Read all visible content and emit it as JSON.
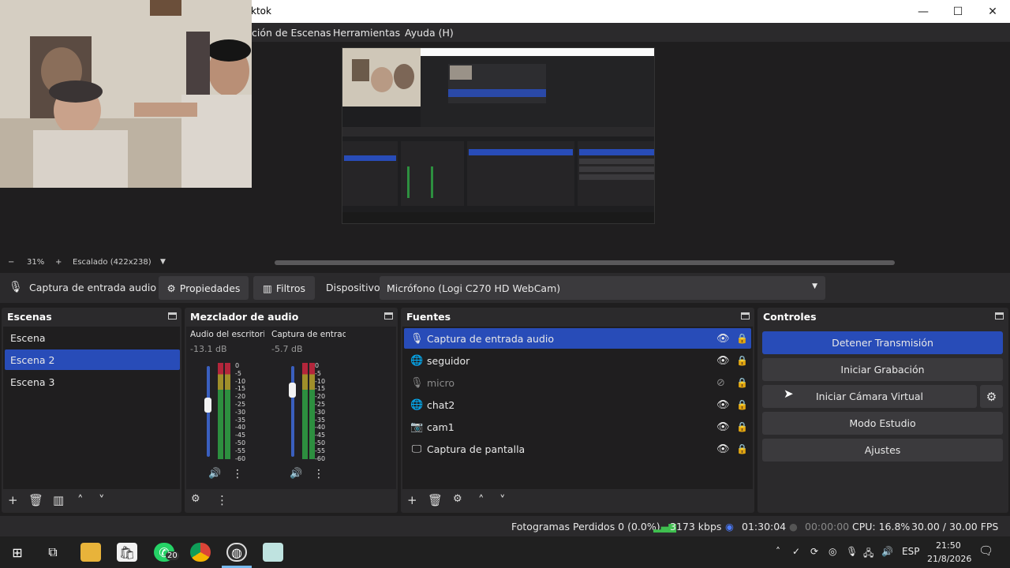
{
  "window": {
    "title": "ktok",
    "minimize": "—",
    "maximize": "☐",
    "close": "✕"
  },
  "menu": {
    "items": [
      "ción de Escenas",
      "Herramientas",
      "Ayuda (H)"
    ]
  },
  "zoom": {
    "minus": "−",
    "percent": "31%",
    "plus": "+",
    "scaling": "Escalado (422x238)",
    "dropdown": "▼"
  },
  "source_toolbar": {
    "source_name": "Captura de entrada audio",
    "properties": "Propiedades",
    "filters": "Filtros",
    "device_label": "Dispositivo",
    "device_value": "Micrófono (Logi C270 HD WebCam)"
  },
  "scenes": {
    "title": "Escenas",
    "items": [
      {
        "label": "Escena",
        "selected": false
      },
      {
        "label": "Escena 2",
        "selected": true
      },
      {
        "label": "Escena 3",
        "selected": false
      }
    ]
  },
  "mixer": {
    "title": "Mezclador de audio",
    "channels": [
      {
        "name": "Audio del escritorio",
        "db": "-13.1 dB",
        "level": 0.72
      },
      {
        "name": "Captura de entrada audio",
        "db": "-5.7 dB",
        "level": 0.86
      }
    ],
    "scale": [
      "0",
      "-5",
      "-10",
      "-15",
      "-20",
      "-25",
      "-30",
      "-35",
      "-40",
      "-45",
      "-50",
      "-55",
      "-60"
    ]
  },
  "sources": {
    "title": "Fuentes",
    "items": [
      {
        "label": "Captura de entrada audio",
        "icon": "mic-icon",
        "visible": true,
        "selected": true
      },
      {
        "label": "seguidor",
        "icon": "browser-icon",
        "visible": true,
        "selected": false
      },
      {
        "label": "micro",
        "icon": "mic-icon",
        "visible": false,
        "selected": false
      },
      {
        "label": "chat2",
        "icon": "browser-icon",
        "visible": true,
        "selected": false
      },
      {
        "label": "cam1",
        "icon": "camera-icon",
        "visible": true,
        "selected": false
      },
      {
        "label": "Captura de pantalla",
        "icon": "monitor-icon",
        "visible": true,
        "selected": false
      }
    ]
  },
  "controls": {
    "title": "Controles",
    "buttons": [
      "Detener Transmisión",
      "Iniciar Grabación",
      "Iniciar Cámara Virtual",
      "Modo Estudio",
      "Ajustes"
    ]
  },
  "status": {
    "dropped_frames": "Fotogramas Perdidos 0 (0.0%)",
    "bitrate": "3173 kbps",
    "stream_time": "01:30:04",
    "rec_time": "00:00:00",
    "cpu": "CPU: 16.8%",
    "fps": "30.00 / 30.00 FPS"
  },
  "taskbar": {
    "whatsapp_badge": "20",
    "language": "ESP",
    "time": "21:50",
    "date": "21/8/2026"
  },
  "colors": {
    "accent": "#284cb8",
    "panel": "#2b2a2c",
    "background": "#1f1e1f"
  }
}
